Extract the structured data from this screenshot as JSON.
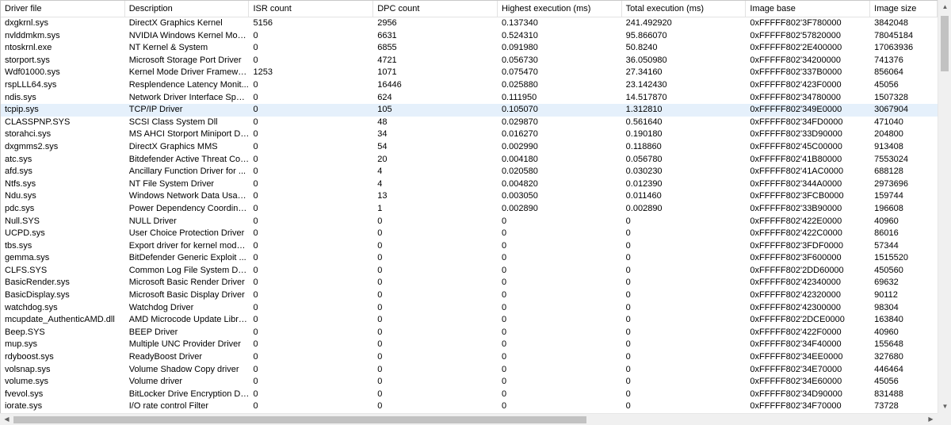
{
  "columns": [
    "Driver file",
    "Description",
    "ISR count",
    "DPC count",
    "Highest execution (ms)",
    "Total execution (ms)",
    "Image base",
    "Image size"
  ],
  "selected_row": 7,
  "rows": [
    [
      "dxgkrnl.sys",
      "DirectX Graphics Kernel",
      "5156",
      "2956",
      "0.137340",
      "241.492920",
      "0xFFFFF802'3F780000",
      "3842048"
    ],
    [
      "nvlddmkm.sys",
      "NVIDIA Windows Kernel Mod...",
      "0",
      "6631",
      "0.524310",
      "95.866070",
      "0xFFFFF802'57820000",
      "78045184"
    ],
    [
      "ntoskrnl.exe",
      "NT Kernel & System",
      "0",
      "6855",
      "0.091980",
      "50.8240",
      "0xFFFFF802'2E400000",
      "17063936"
    ],
    [
      "storport.sys",
      "Microsoft Storage Port Driver",
      "0",
      "4721",
      "0.056730",
      "36.050980",
      "0xFFFFF802'34200000",
      "741376"
    ],
    [
      "Wdf01000.sys",
      "Kernel Mode Driver Framewor...",
      "1253",
      "1071",
      "0.075470",
      "27.34160",
      "0xFFFFF802'337B0000",
      "856064"
    ],
    [
      "rspLLL64.sys",
      "Resplendence Latency Monit...",
      "0",
      "16446",
      "0.025880",
      "23.142430",
      "0xFFFFF802'423F0000",
      "45056"
    ],
    [
      "ndis.sys",
      "Network Driver Interface Speci...",
      "0",
      "624",
      "0.111950",
      "14.517870",
      "0xFFFFF802'34780000",
      "1507328"
    ],
    [
      "tcpip.sys",
      "TCP/IP Driver",
      "0",
      "105",
      "0.105070",
      "1.312810",
      "0xFFFFF802'349E0000",
      "3067904"
    ],
    [
      "CLASSPNP.SYS",
      "SCSI Class System Dll",
      "0",
      "48",
      "0.029870",
      "0.561640",
      "0xFFFFF802'34FD0000",
      "471040"
    ],
    [
      "storahci.sys",
      "MS AHCI Storport Miniport Dri...",
      "0",
      "34",
      "0.016270",
      "0.190180",
      "0xFFFFF802'33D90000",
      "204800"
    ],
    [
      "dxgmms2.sys",
      "DirectX Graphics MMS",
      "0",
      "54",
      "0.002990",
      "0.118860",
      "0xFFFFF802'45C00000",
      "913408"
    ],
    [
      "atc.sys",
      "Bitdefender Active Threat Cont...",
      "0",
      "20",
      "0.004180",
      "0.056780",
      "0xFFFFF802'41B80000",
      "7553024"
    ],
    [
      "afd.sys",
      "Ancillary Function Driver for ...",
      "0",
      "4",
      "0.020580",
      "0.030230",
      "0xFFFFF802'41AC0000",
      "688128"
    ],
    [
      "Ntfs.sys",
      "NT File System Driver",
      "0",
      "4",
      "0.004820",
      "0.012390",
      "0xFFFFF802'344A0000",
      "2973696"
    ],
    [
      "Ndu.sys",
      "Windows Network Data Usag...",
      "0",
      "13",
      "0.003050",
      "0.011460",
      "0xFFFFF802'3FCB0000",
      "159744"
    ],
    [
      "pdc.sys",
      "Power Dependency Coordinat...",
      "0",
      "1",
      "0.002890",
      "0.002890",
      "0xFFFFF802'33B90000",
      "196608"
    ],
    [
      "Null.SYS",
      "NULL Driver",
      "0",
      "0",
      "0",
      "0",
      "0xFFFFF802'422E0000",
      "40960"
    ],
    [
      "UCPD.sys",
      "User Choice Protection Driver",
      "0",
      "0",
      "0",
      "0",
      "0xFFFFF802'422C0000",
      "86016"
    ],
    [
      "tbs.sys",
      "Export driver for kernel mode ...",
      "0",
      "0",
      "0",
      "0",
      "0xFFFFF802'3FDF0000",
      "57344"
    ],
    [
      "gemma.sys",
      "BitDefender Generic Exploit ...",
      "0",
      "0",
      "0",
      "0",
      "0xFFFFF802'3F600000",
      "1515520"
    ],
    [
      "CLFS.SYS",
      "Common Log File System Dri...",
      "0",
      "0",
      "0",
      "0",
      "0xFFFFF802'2DD60000",
      "450560"
    ],
    [
      "BasicRender.sys",
      "Microsoft Basic Render Driver",
      "0",
      "0",
      "0",
      "0",
      "0xFFFFF802'42340000",
      "69632"
    ],
    [
      "BasicDisplay.sys",
      "Microsoft Basic Display Driver",
      "0",
      "0",
      "0",
      "0",
      "0xFFFFF802'42320000",
      "90112"
    ],
    [
      "watchdog.sys",
      "Watchdog Driver",
      "0",
      "0",
      "0",
      "0",
      "0xFFFFF802'42300000",
      "98304"
    ],
    [
      "mcupdate_AuthenticAMD.dll",
      "AMD Microcode Update Library",
      "0",
      "0",
      "0",
      "0",
      "0xFFFFF802'2DCE0000",
      "163840"
    ],
    [
      "Beep.SYS",
      "BEEP Driver",
      "0",
      "0",
      "0",
      "0",
      "0xFFFFF802'422F0000",
      "40960"
    ],
    [
      "mup.sys",
      "Multiple UNC Provider Driver",
      "0",
      "0",
      "0",
      "0",
      "0xFFFFF802'34F40000",
      "155648"
    ],
    [
      "rdyboost.sys",
      "ReadyBoost Driver",
      "0",
      "0",
      "0",
      "0",
      "0xFFFFF802'34EE0000",
      "327680"
    ],
    [
      "volsnap.sys",
      "Volume Shadow Copy driver",
      "0",
      "0",
      "0",
      "0",
      "0xFFFFF802'34E70000",
      "446464"
    ],
    [
      "volume.sys",
      "Volume driver",
      "0",
      "0",
      "0",
      "0",
      "0xFFFFF802'34E60000",
      "45056"
    ],
    [
      "fvevol.sys",
      "BitLocker Drive Encryption Dri...",
      "0",
      "0",
      "0",
      "0",
      "0xFFFFF802'34D90000",
      "831488"
    ],
    [
      "iorate.sys",
      "I/O rate control Filter",
      "0",
      "0",
      "0",
      "0",
      "0xFFFFF802'34F70000",
      "73728"
    ]
  ]
}
